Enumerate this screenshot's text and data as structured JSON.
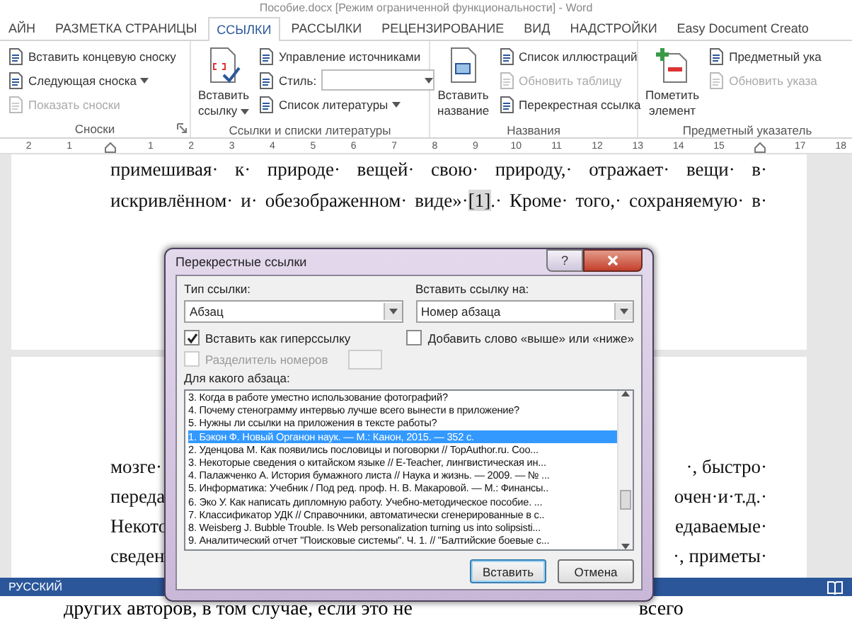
{
  "window": {
    "title": "Пособие.docx [Режим ограниченной функциональности] - Word"
  },
  "tabs": [
    {
      "label": "АЙН",
      "selected": false
    },
    {
      "label": "РАЗМЕТКА СТРАНИЦЫ",
      "selected": false
    },
    {
      "label": "ССЫЛКИ",
      "selected": true
    },
    {
      "label": "РАССЫЛКИ",
      "selected": false
    },
    {
      "label": "РЕЦЕНЗИРОВАНИЕ",
      "selected": false
    },
    {
      "label": "ВИД",
      "selected": false
    },
    {
      "label": "НАДСТРОЙКИ",
      "selected": false
    },
    {
      "label": "Easy Document Creato",
      "selected": false
    }
  ],
  "ribbon": {
    "groups": [
      {
        "label": "Сноски",
        "launcher": true,
        "small": [
          {
            "label": "Вставить концевую сноску",
            "kind": "button",
            "dropdown": false,
            "disabled": false
          },
          {
            "label": "Следующая сноска",
            "kind": "button",
            "dropdown": true,
            "disabled": false
          },
          {
            "label": "Показать сноски",
            "kind": "button",
            "dropdown": false,
            "disabled": true
          }
        ]
      },
      {
        "label": "Ссылки и списки литературы",
        "large": {
          "lines": [
            "Вставить",
            "ссылку"
          ],
          "dropdown": true
        },
        "small": [
          {
            "label": "Управление источниками",
            "kind": "button",
            "dropdown": false,
            "disabled": false
          },
          {
            "label": "Стиль:",
            "kind": "combo",
            "dropdown": true,
            "disabled": false
          },
          {
            "label": "Список литературы",
            "kind": "button",
            "dropdown": true,
            "disabled": false
          }
        ]
      },
      {
        "label": "Названия",
        "large": {
          "lines": [
            "Вставить",
            "название"
          ],
          "dropdown": false
        },
        "small": [
          {
            "label": "Список иллюстраций",
            "kind": "button",
            "dropdown": false,
            "disabled": false
          },
          {
            "label": "Обновить таблицу",
            "kind": "button",
            "dropdown": false,
            "disabled": true
          },
          {
            "label": "Перекрестная ссылка",
            "kind": "button",
            "dropdown": false,
            "disabled": false
          }
        ]
      },
      {
        "label": "Предметный указатель",
        "large": {
          "lines": [
            "Пометить",
            "элемент"
          ],
          "dropdown": false
        },
        "small": [
          {
            "label": "Предметный ука",
            "kind": "button",
            "dropdown": false,
            "disabled": false
          },
          {
            "label": "Обновить указа",
            "kind": "button",
            "dropdown": false,
            "disabled": true
          }
        ]
      }
    ]
  },
  "ruler": {
    "left_numbers": [
      "2",
      "1"
    ],
    "body_numbers": [
      "1",
      "2",
      "3",
      "4",
      "5",
      "6",
      "7",
      "8",
      "9",
      "10",
      "11",
      "12",
      "13",
      "14",
      "15"
    ],
    "right_numbers": [
      "17",
      "18"
    ]
  },
  "page_1": {
    "lines": [
      {
        "before": "примешивая· к· природе· вещей· свою· природу,· отражает· вещи· в·"
      },
      {
        "before": "искривлённом· и· обезображенном· виде»·",
        "field": "[1]",
        "after": ".· Кроме· того,· сохраняемую· в·"
      }
    ]
  },
  "page_2": {
    "lines": [
      {
        "left": "мозге·",
        "right": "·, быстро·"
      },
      {
        "left": "переда",
        "right": "очен·и·т.д.·"
      },
      {
        "left": "Некото",
        "right": "едаваемые·"
      },
      {
        "left": "сведен",
        "right": "·, приметы·"
      }
    ]
  },
  "dialog": {
    "title": "Перекрестные ссылки",
    "help": "?",
    "type_label": "Тип ссылки:",
    "type_value": "Абзац",
    "insert_label": "Вставить ссылку на:",
    "insert_value": "Номер абзаца",
    "checkboxes": [
      {
        "label": "Вставить как гиперссылку",
        "checked": true,
        "disabled": false
      },
      {
        "label": "Добавить слово «выше» или «ниже»",
        "checked": false,
        "disabled": false
      },
      {
        "label": "Разделитель номеров",
        "checked": false,
        "disabled": true
      }
    ],
    "list_label": "Для какого абзаца:",
    "items": [
      {
        "text": "3. Когда в работе уместно использование фотографий?",
        "selected": false
      },
      {
        "text": "4. Почему стенограмму интервью лучше всего вынести в приложение?",
        "selected": false
      },
      {
        "text": "5. Нужны ли ссылки на приложения в тексте работы?",
        "selected": false
      },
      {
        "text": "1. Бэкон Ф. Новый Органон наук. — М.: Канон, 2015. — 352 с.",
        "selected": true
      },
      {
        "text": "2. Уденцова М. Как появились пословицы и поговорки // TopAuthor.ru. Coo...",
        "selected": false
      },
      {
        "text": "3. Некоторые сведения о китайском языке // E-Teacher, лингвистическая ин...",
        "selected": false
      },
      {
        "text": "4. Палажченко А. История бумажного листа // Наука и жизнь. — 2009. — № ...",
        "selected": false
      },
      {
        "text": "5. Информатика: Учебник / Под ред. проф. Н. В. Макаровой. — М.: Финансы..",
        "selected": false
      },
      {
        "text": "6. Эко У. Как написать дипломную работу. Учебно-методическое пособие. ...",
        "selected": false
      },
      {
        "text": "7. Классификатор УДК // Справочники, автоматически сгенерированные в с..",
        "selected": false
      },
      {
        "text": "8. Weisberg J. Bubble Trouble. Is Web personalization turning us into solipsisti...",
        "selected": false
      },
      {
        "text": "9. Аналитический отчет \"Поисковые системы\". Ч. 1. // \"Балтийские боевые с...",
        "selected": false
      }
    ],
    "buttons": [
      {
        "label": "Вставить",
        "default": true
      },
      {
        "label": "Отмена",
        "default": false
      }
    ]
  },
  "status_bar": {
    "language": "РУССКИЙ"
  },
  "lower_window": {
    "left": "других авторов, в том случае, если это не",
    "right": "всего"
  }
}
